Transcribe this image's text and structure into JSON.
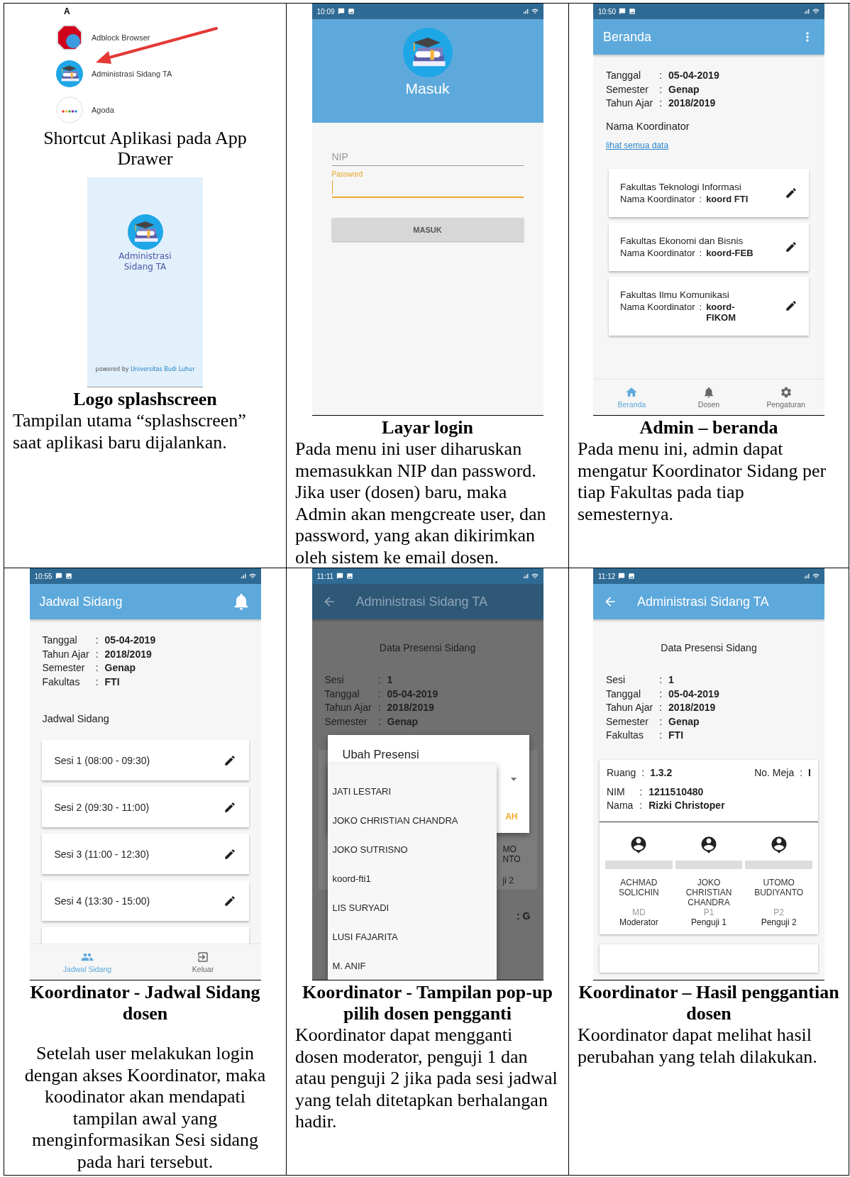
{
  "cells": [
    {
      "kind": "drawer",
      "index_letter": "A",
      "apps": [
        {
          "name": "Adblock Browser",
          "kind": "adblock",
          "pointed": false
        },
        {
          "name": "Administrasi Sidang TA",
          "kind": "graduation",
          "pointed": true
        },
        {
          "name": "Agoda",
          "kind": "agoda",
          "pointed": false
        }
      ],
      "caption": "Shortcut Aplikasi pada App Drawer",
      "splash": {
        "app_name": "Administrasi Sidang TA",
        "powered_by": "powered by",
        "org": "Universitas Budi Luhur"
      },
      "title": "Logo splashscreen",
      "description": "Tampilan utama “splashscreen” saat aplikasi baru dijalankan."
    },
    {
      "kind": "login",
      "phone": {
        "time": "10:09",
        "header": "Masuk",
        "fields": [
          {
            "placeholder": "NIP",
            "focused": false
          },
          {
            "label": "Password",
            "focused": true
          }
        ],
        "button": "MASUK"
      },
      "title": "Layar login",
      "description": "Pada menu ini user diharuskan memasukkan NIP dan password. Jika user (dosen) baru, maka Admin akan mengcreate user, dan password, yang akan dikirimkan oleh sistem ke email dosen."
    },
    {
      "kind": "admin",
      "phone": {
        "time": "10:50",
        "app_bar": "Beranda",
        "info": [
          {
            "label": "Tanggal",
            "sep": ":",
            "value": "05-04-2019"
          },
          {
            "label": "Semester",
            "sep": ":",
            "value": "Genap"
          },
          {
            "label": "Tahun Ajar",
            "sep": ":",
            "value": "2018/2019"
          }
        ],
        "section": "Nama Koordinator",
        "link": "lihat semua data",
        "cards": [
          {
            "faculty": "Fakultas Teknologi Informasi",
            "label": "Nama Koordinator",
            "sep": ":",
            "value": "koord FTI"
          },
          {
            "faculty": "Fakultas Ekonomi dan Bisnis",
            "label": "Nama Koordinator",
            "sep": ":",
            "value": "koord-FEB"
          },
          {
            "faculty": "Fakultas Ilmu Komunikasi",
            "label": "Nama Koordinator",
            "sep": ":",
            "value": "koord-FIKOM"
          }
        ],
        "nav": [
          {
            "label": "Beranda",
            "kind": "home",
            "selected": true
          },
          {
            "label": "Dosen",
            "kind": "bell",
            "selected": false
          },
          {
            "label": "Pengaturan",
            "kind": "gear",
            "selected": false
          }
        ]
      },
      "title": "Admin – beranda",
      "description": "Pada menu ini, admin dapat mengatur Koordinator Sidang per tiap Fakultas pada tiap semesternya."
    },
    {
      "kind": "jadwal",
      "phone": {
        "time": "10:55",
        "app_bar": "Jadwal Sidang",
        "info": [
          {
            "label": "Tanggal",
            "sep": ":",
            "value": "05-04-2019"
          },
          {
            "label": "Tahun Ajar",
            "sep": ":",
            "value": "2018/2019"
          },
          {
            "label": "Semester",
            "sep": ":",
            "value": "Genap"
          },
          {
            "label": "Fakultas",
            "sep": ":",
            "value": "FTI"
          }
        ],
        "section": "Jadwal Sidang",
        "sessions": [
          "Sesi 1 (08:00 - 09:30)",
          "Sesi 2 (09:30 - 11:00)",
          "Sesi 3 (11:00 - 12:30)",
          "Sesi 4 (13:30 - 15:00)"
        ],
        "nav": [
          {
            "label": "Jadwal Sidang",
            "kind": "people",
            "selected": true
          },
          {
            "label": "Keluar",
            "kind": "exit",
            "selected": false
          }
        ]
      },
      "title": "Koordinator - Jadwal Sidang dosen",
      "description": "Setelah user melakukan login dengan akses Koordinator, maka koodinator akan mendapati tampilan awal yang menginformasikan Sesi sidang pada hari tersebut."
    },
    {
      "kind": "popup",
      "phone": {
        "time": "11:11",
        "app_bar": "Administrasi Sidang TA",
        "heading": "Data Presensi Sidang",
        "info": [
          {
            "label": "Sesi",
            "sep": ":",
            "value": "1"
          },
          {
            "label": "Tanggal",
            "sep": ":",
            "value": "05-04-2019"
          },
          {
            "label": "Tahun Ajar",
            "sep": ":",
            "value": "2018/2019"
          },
          {
            "label": "Semester",
            "sep": ":",
            "value": "Genap"
          }
        ],
        "dialog": {
          "title": "Ubah Presensi",
          "action": "AH",
          "options": [
            "JATI LESTARI",
            "JOKO CHRISTIAN CHANDRA",
            "JOKO SUTRISNO",
            "koord-fti1",
            "LIS SURYADI",
            "LUSI FAJARITA",
            "M. ANIF"
          ]
        },
        "behind": [
          "MO",
          "NTO",
          "ji 2"
        ],
        "behind_bottom": ": G"
      },
      "title": "Koordinator - Tampilan pop-up pilih dosen pengganti",
      "description": "Koordinator dapat mengganti dosen moderator, penguji 1 dan atau penguji 2 jika pada sesi jadwal yang telah ditetapkan berhalangan hadir."
    },
    {
      "kind": "result",
      "phone": {
        "time": "11:12",
        "app_bar": "Administrasi Sidang TA",
        "heading": "Data Presensi Sidang",
        "info": [
          {
            "label": "Sesi",
            "sep": ":",
            "value": "1"
          },
          {
            "label": "Tanggal",
            "sep": ":",
            "value": "05-04-2019"
          },
          {
            "label": "Tahun Ajar",
            "sep": ":",
            "value": "2018/2019"
          },
          {
            "label": "Semester",
            "sep": ":",
            "value": "Genap"
          },
          {
            "label": "Fakultas",
            "sep": ":",
            "value": "FTI"
          }
        ],
        "card": {
          "room": {
            "label": "Ruang",
            "sep": ":",
            "value": "1.3.2"
          },
          "desk": {
            "label": "No. Meja",
            "sep": ":",
            "value": "I"
          },
          "student": [
            {
              "label": "NIM",
              "sep": ":",
              "value": "1211510480"
            },
            {
              "label": "Nama",
              "sep": ":",
              "value": "Rizki Christoper"
            }
          ],
          "examiners": [
            {
              "name": "ACHMAD SOLICHIN",
              "code": "MD",
              "role": "Moderator"
            },
            {
              "name": "JOKO CHRISTIAN CHANDRA",
              "code": "P1",
              "role": "Penguji 1"
            },
            {
              "name": "UTOMO BUDIYANTO",
              "code": "P2",
              "role": "Penguji 2"
            }
          ]
        }
      },
      "title": "Koordinator – Hasil penggantian dosen",
      "description": "Koordinator dapat melihat hasil perubahan yang telah dilakukan."
    }
  ]
}
